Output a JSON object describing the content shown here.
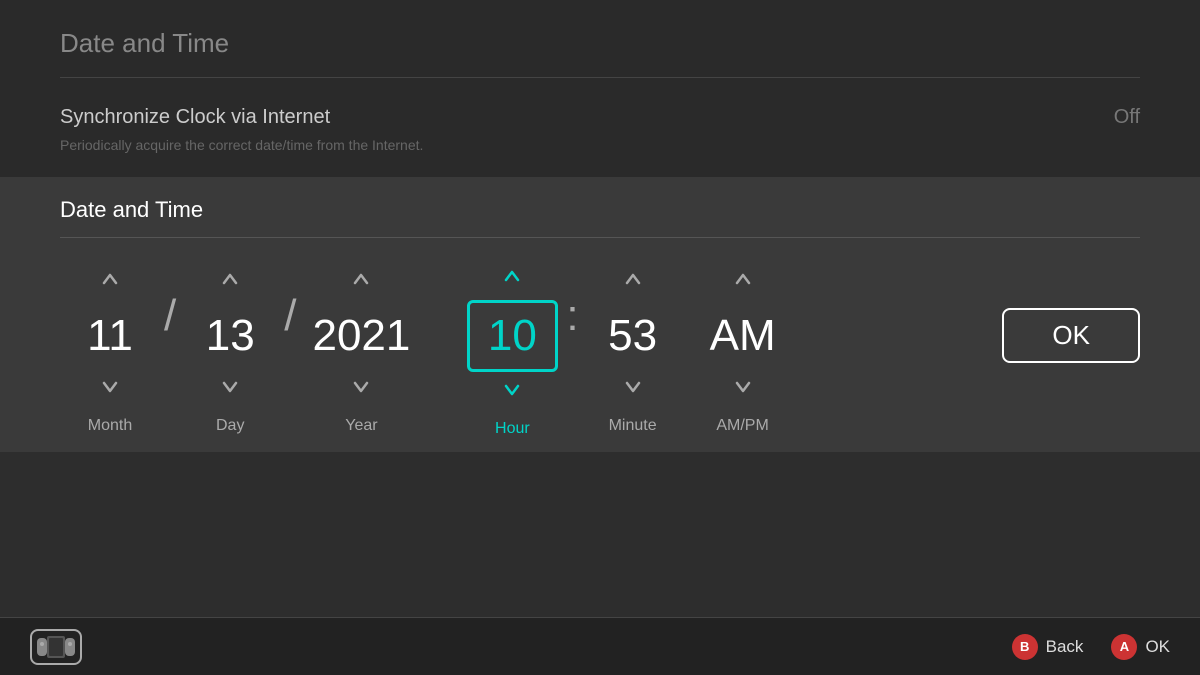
{
  "page": {
    "title": "Date and Time",
    "top_title": "Date and Time"
  },
  "sync": {
    "label": "Synchronize Clock via Internet",
    "value": "Off",
    "description": "Periodically acquire the correct date/time from the Internet."
  },
  "datetime_section": {
    "title": "Date and Time"
  },
  "pickers": [
    {
      "id": "month",
      "value": "11",
      "label": "Month",
      "active": false
    },
    {
      "id": "day",
      "value": "13",
      "label": "Day",
      "active": false
    },
    {
      "id": "year",
      "value": "2021",
      "label": "Year",
      "active": false
    },
    {
      "id": "hour",
      "value": "10",
      "label": "Hour",
      "active": true
    },
    {
      "id": "minute",
      "value": "53",
      "label": "Minute",
      "active": false
    },
    {
      "id": "ampm",
      "value": "AM",
      "label": "AM/PM",
      "active": false
    }
  ],
  "separators": {
    "date_sep": "/",
    "time_sep": ":"
  },
  "buttons": {
    "ok": "OK"
  },
  "bottom_bar": {
    "back_label": "Back",
    "ok_label": "OK",
    "back_btn": "B",
    "ok_btn": "A"
  }
}
